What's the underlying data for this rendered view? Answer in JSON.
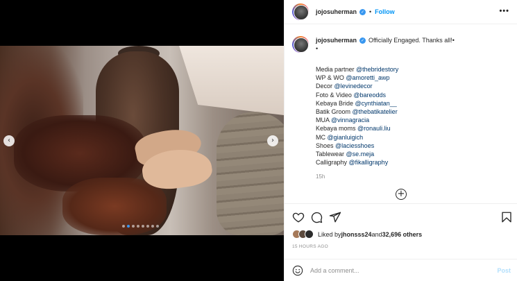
{
  "header": {
    "username": "jojosuherman",
    "separator": "•",
    "follow_label": "Follow",
    "more_label": "•••"
  },
  "media": {
    "prev_icon": "‹",
    "next_icon": "›",
    "dots_count": 8,
    "active_dot": 1
  },
  "caption": {
    "username": "jojosuherman",
    "text": "Officially Engaged. Thanks all!•",
    "bullet": "•",
    "lines": [
      {
        "label": "Media partner ",
        "mention": "@thebridestory"
      },
      {
        "label": "WP & WO ",
        "mention": "@amoretti_awp"
      },
      {
        "label": "Decor ",
        "mention": "@levinedecor"
      },
      {
        "label": "Foto & Video ",
        "mention": "@bareodds"
      },
      {
        "label": "Kebaya Bride ",
        "mention": "@cynthiatan__"
      },
      {
        "label": "Batik Groom ",
        "mention": "@thebatikatelier"
      },
      {
        "label": "MUA ",
        "mention": "@vinnagracia"
      },
      {
        "label": "Kebaya moms ",
        "mention": "@ronauli.liu"
      },
      {
        "label": "MC ",
        "mention": "@gianluigich"
      },
      {
        "label": "Shoes ",
        "mention": "@laciesshoes"
      },
      {
        "label": "Tablewear ",
        "mention": "@se.meja"
      },
      {
        "label": "Calligraphy ",
        "mention": "@fikalligraphy"
      }
    ],
    "time": "15h"
  },
  "likes": {
    "prefix": "Liked by ",
    "user": "jhonsss24",
    "middle": " and ",
    "count": "32,696 others"
  },
  "posted_ago": "15 HOURS AGO",
  "comment": {
    "placeholder": "Add a comment...",
    "post_label": "Post"
  },
  "colors": {
    "accent": "#0095f6",
    "verified": "#3897f0",
    "mention": "#00376b"
  }
}
